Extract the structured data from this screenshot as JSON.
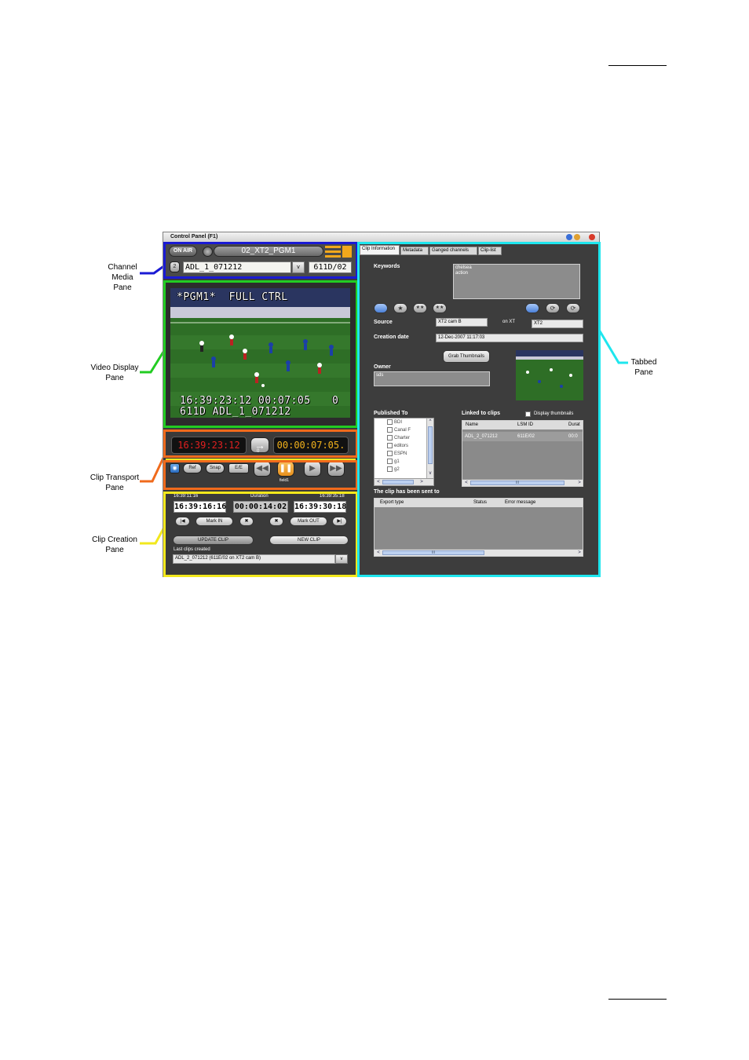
{
  "window": {
    "title": "Control Panel (F1)"
  },
  "callouts": {
    "channel_media_pane": "Channel Media Pane",
    "video_display_pane": "Video Display Pane",
    "clip_transport_pane": "Clip Transport Pane",
    "clip_creation_pane": "Clip Creation Pane",
    "tabbed_pane": "Tabbed Pane"
  },
  "colors": {
    "channel_outline": "#1a1ad4",
    "video_outline": "#22cc22",
    "transport_outline": "#f06a1c",
    "creation_outline": "#f2e81c",
    "tabbed_outline": "#1ee6ee"
  },
  "channel": {
    "on_air_label": "ON AIR",
    "channel_name": "02_XT2_PGM1",
    "clip_name": "ADL_1_071212",
    "dropdown_arrow": "v",
    "clip_id": "611D/02",
    "menu_icon": "menu-lines-icon"
  },
  "video": {
    "osd_top": "*PGM1*  FULL CTRL",
    "osd_timecodes": "16:39:23:12 00:07:05",
    "osd_zero": "0",
    "osd_clip": "611D ADL_1_071212"
  },
  "transport": {
    "current_tc": "16:39:23:12",
    "remaining_tc": "00:00:07:05.",
    "position_marker": "0",
    "buttons": {
      "ref": "Ref",
      "snap": "Snap",
      "ee": "E/E"
    },
    "field_label": "field1"
  },
  "creation": {
    "in_small": "16:39:11:16",
    "duration_label": "Duration",
    "out_small": "16:39:35:18",
    "in_tc": "16:39:16:16",
    "duration_tc": "00:00:14:02",
    "out_tc": "16:39:30:18",
    "mark_in": "Mark IN",
    "mark_out": "Mark OUT",
    "update_clip": "UPDATE CLIP",
    "new_clip": "NEW CLIP",
    "last_clips_label": "Last clips created",
    "last_clip_value": "ADL_2_071212 (611E/02 on XT2 cam B)",
    "dropdown_arrow": "v"
  },
  "tabs": [
    {
      "label": "Clip Information",
      "active": true
    },
    {
      "label": "Metadata",
      "active": false
    },
    {
      "label": "Ganged channels",
      "active": false
    },
    {
      "label": "Clip-list",
      "active": false
    }
  ],
  "clip_info": {
    "keywords_label": "Keywords",
    "keywords": [
      "chelsea",
      "action"
    ],
    "source_label": "Source",
    "source_value": "XT2 cam B",
    "on_xt_label": "on XT",
    "on_xt_value": "XT2",
    "creation_date_label": "Creation date",
    "creation_date_value": "12-Dec-2007 11:17:03",
    "grab_thumbnails": "Grab Thumbnails",
    "owner_label": "Owner",
    "owner_value": "sds",
    "published_to_label": "Published To",
    "published_to_items": [
      "BDI",
      "Canal F",
      "Charter",
      "editors",
      "ESPN",
      "g1",
      "g2"
    ],
    "linked_to_clips_label": "Linked to clips",
    "display_thumbnails_label": "Display thumbnails",
    "linked_columns": [
      "Name",
      "LSM ID",
      "Durat"
    ],
    "linked_rows": [
      [
        "ADL_2_071212",
        "611E/02",
        "00:0"
      ]
    ],
    "sent_to_label": "The clip has been sent to",
    "sent_columns": [
      "Export type",
      "Status",
      "Error message"
    ],
    "scroll_right": ">",
    "scroll_left": "<",
    "scroll_up": "^",
    "scroll_down": "v",
    "scroll_thumb": "III"
  }
}
